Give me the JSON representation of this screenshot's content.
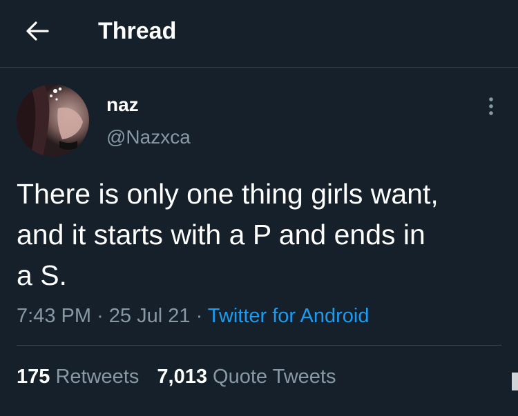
{
  "header": {
    "title": "Thread",
    "back_icon": "arrow-left-icon"
  },
  "tweet": {
    "author": {
      "display_name": "naz",
      "handle": "@Nazxca"
    },
    "text": "There is only one thing girls want,\nand it starts with a P and ends in\na S.",
    "time": "7:43 PM",
    "date": "25 Jul 21",
    "separator": "·",
    "source": "Twitter for Android"
  },
  "stats": {
    "retweets_count": "175",
    "retweets_label": "Retweets",
    "quotes_count": "7,013",
    "quotes_label": "Quote Tweets"
  },
  "colors": {
    "background": "#15202b",
    "divider": "#38444d",
    "secondary_text": "#8899a6",
    "link": "#1d9bf0"
  }
}
